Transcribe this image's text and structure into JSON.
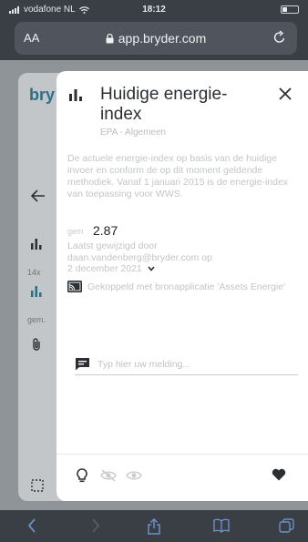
{
  "status_bar": {
    "carrier": "vodafone NL",
    "time": "18:12"
  },
  "browser": {
    "aa_label": "AA",
    "url": "app.bryder.com"
  },
  "background_page": {
    "logo_text": "bry",
    "label_14x": "14x",
    "label_gem": "gem."
  },
  "modal": {
    "title": "Huidige energie-index",
    "subtitle": "EPA - Algemeen",
    "description": "De actuele energie-index op basis van de huidige invoer en conform de op dit moment geldende methodiek. Vanaf 1 januari 2015 is de energie-index van toepassing voor WWS.",
    "value_label": "gem",
    "value": "2.87",
    "changed_by_text": "Laatst gewijzigd door daan.vandenberg@bryder.com op",
    "changed_date": "2 december 2021",
    "linked_text": "Gekoppeld met bronapplicatie 'Assets Energie'",
    "note_placeholder": "Typ hier uw melding..."
  },
  "colors": {
    "accent": "#2b6f86",
    "overlay": "#8f9499",
    "modal_bg": "#ffffff"
  }
}
